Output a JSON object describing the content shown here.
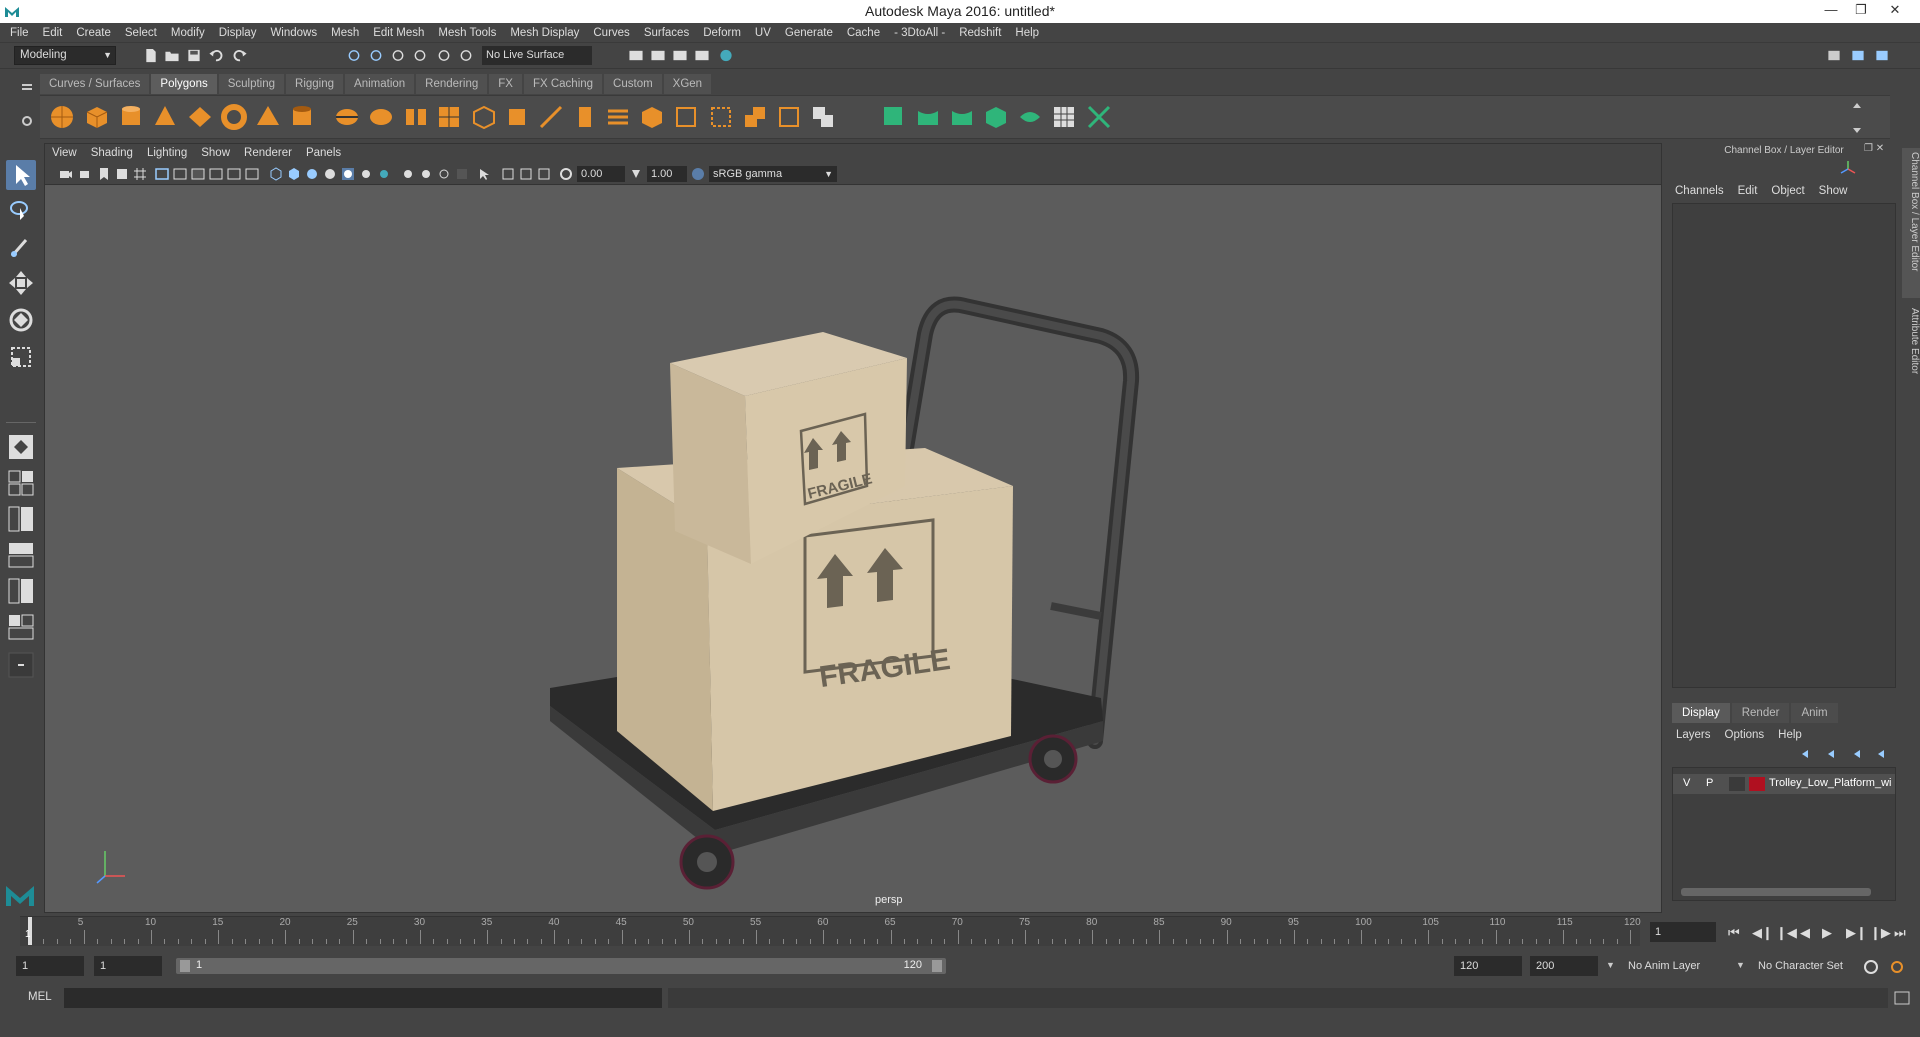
{
  "window": {
    "title": "Autodesk Maya 2016: untitled*"
  },
  "menu": [
    "File",
    "Edit",
    "Create",
    "Select",
    "Modify",
    "Display",
    "Windows",
    "Mesh",
    "Edit Mesh",
    "Mesh Tools",
    "Mesh Display",
    "Curves",
    "Surfaces",
    "Deform",
    "UV",
    "Generate",
    "Cache",
    "- 3DtoAll -",
    "Redshift",
    "Help"
  ],
  "status": {
    "mode": "Modeling",
    "live_surface": "No Live Surface"
  },
  "shelf_tabs": [
    "Curves / Surfaces",
    "Polygons",
    "Sculpting",
    "Rigging",
    "Animation",
    "Rendering",
    "FX",
    "FX Caching",
    "Custom",
    "XGen"
  ],
  "active_shelf_tab": "Polygons",
  "viewport": {
    "menu": [
      "View",
      "Shading",
      "Lighting",
      "Show",
      "Renderer",
      "Panels"
    ],
    "exposure": "0.00",
    "gamma": "1.00",
    "color_space": "sRGB gamma",
    "camera_label": "persp",
    "box_label_1": "FRAGILE",
    "box_label_2": "FRAGILE"
  },
  "channel_box": {
    "title": "Channel Box / Layer Editor",
    "menu": [
      "Channels",
      "Edit",
      "Object",
      "Show"
    ],
    "side_tab_1": "Channel Box / Layer Editor",
    "side_tab_2": "Attribute Editor"
  },
  "layer_editor": {
    "tabs": [
      "Display",
      "Render",
      "Anim"
    ],
    "active_tab": "Display",
    "menu": [
      "Layers",
      "Options",
      "Help"
    ],
    "layer": {
      "visible": "V",
      "playback": "P",
      "name": "Trolley_Low_Platform_wi",
      "color": "#b01020"
    }
  },
  "timeline": {
    "ticks": [
      5,
      10,
      15,
      20,
      25,
      30,
      35,
      40,
      45,
      50,
      55,
      60,
      65,
      70,
      75,
      80,
      85,
      90,
      95,
      100,
      105,
      110,
      115,
      120
    ],
    "current_frame": "1",
    "current_marker": "1"
  },
  "range": {
    "start": "1",
    "playback_start": "1",
    "slider_start": "1",
    "slider_end": "120",
    "playback_end": "120",
    "end": "200",
    "anim_layer": "No Anim Layer",
    "character_set": "No Character Set"
  },
  "command": {
    "language": "MEL"
  }
}
